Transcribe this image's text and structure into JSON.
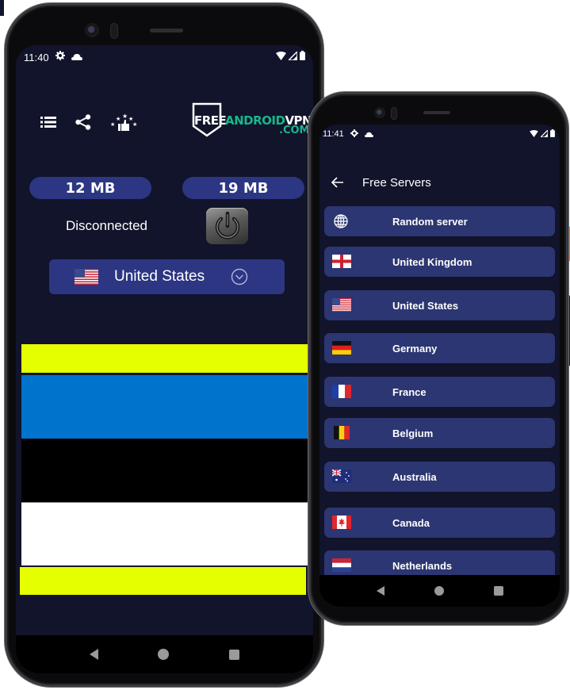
{
  "left_phone": {
    "status_bar": {
      "time": "11:40",
      "icons": [
        "gear-icon",
        "cloud-icon",
        "wifi-icon",
        "signal-icon",
        "battery-icon"
      ]
    },
    "toolbar": {
      "icons": [
        "list-icon",
        "share-icon",
        "rate-icon"
      ]
    },
    "logo": {
      "free": "FREE",
      "android": "ANDROID",
      "vpn": "VPN",
      "com": ".COM"
    },
    "traffic": {
      "download": "12 MB",
      "upload": "19 MB"
    },
    "connection_status": "Disconnected",
    "selected_country": {
      "name": "United States",
      "flag": "us"
    },
    "banner_colors": [
      "#e6ff00",
      "#0073cc",
      "#000000",
      "#ffffff",
      "#e6ff00"
    ]
  },
  "right_phone": {
    "status_bar": {
      "time": "11:41",
      "icons": [
        "gear-icon",
        "cloud-icon",
        "wifi-icon",
        "signal-icon",
        "battery-icon"
      ]
    },
    "header": {
      "title": "Free Servers",
      "back_icon": "arrow-left-icon"
    },
    "servers": [
      {
        "label": "Random server",
        "icon": "globe"
      },
      {
        "label": "United Kingdom",
        "icon": "gb"
      },
      {
        "label": "United States",
        "icon": "us"
      },
      {
        "label": "Germany",
        "icon": "de"
      },
      {
        "label": "France",
        "icon": "fr"
      },
      {
        "label": "Belgium",
        "icon": "be"
      },
      {
        "label": "Australia",
        "icon": "au"
      },
      {
        "label": "Canada",
        "icon": "ca"
      },
      {
        "label": "Netherlands",
        "icon": "nl"
      },
      {
        "label": "",
        "icon": ""
      }
    ]
  },
  "colors": {
    "background": "#11142a",
    "card": "#2c3682",
    "accent": "#18b68c"
  }
}
